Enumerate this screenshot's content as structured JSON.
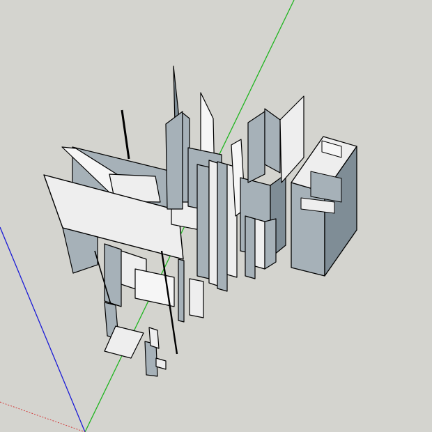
{
  "viewport": {
    "background": "#d4d4cf",
    "colors": {
      "red_axis": "#d23b3b",
      "green_axis": "#1fb51f",
      "blue_axis": "#1a1ad6",
      "edge": "#000000",
      "face_light": "#eeeeee",
      "face_white": "#f6f6f6",
      "face_shade": "#a6b1b8",
      "face_dark": "#7f8d96"
    },
    "icons": {
      "axes": "axis-lines",
      "model": "3d-model-geometry"
    }
  }
}
